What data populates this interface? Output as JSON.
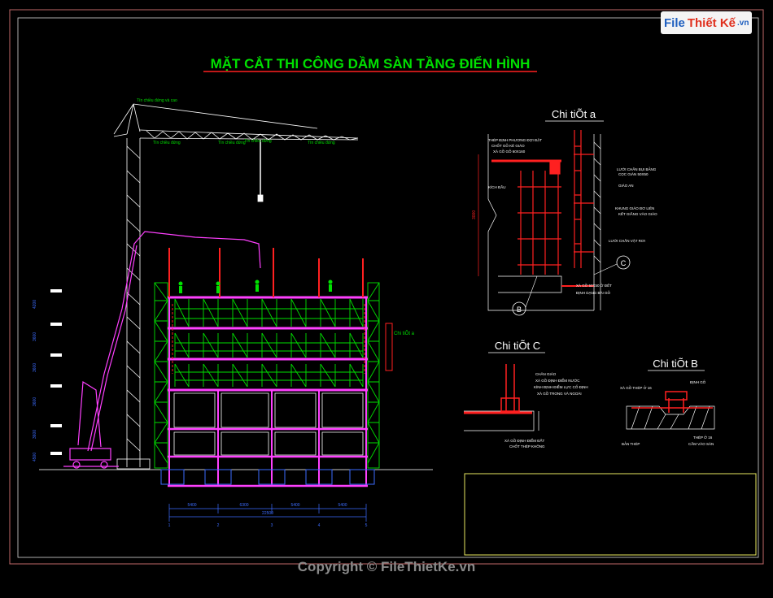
{
  "title": "MẶT CẮT THI CÔNG DẦM SÀN TẦNG ĐIỂN HÌNH",
  "logo": {
    "part1": "File",
    "part2": "Thiết Kế",
    "part3": ".vn"
  },
  "copyright": "Copyright © FileThietKe.vn",
  "detail_a": {
    "title": "Chi tiÕt a",
    "dim": "3000",
    "notes": [
      "THÉP ĐỊNH PHƯƠNG ĐỢI ĐẶT",
      "CHỐT GỖ KÊ GIÁO",
      "XÀ GỒ GỖ 60X160",
      "LƯỚI CHẮN BỤI BẢNG",
      "CỌC GIÀN 50X50",
      "GIÁO AN",
      "KHUNG GIÁO ĐƠ LIÊN",
      "KẾT GIẰNG VÀO GIÁO",
      "LƯỚI CHẮN VẬT RƠI",
      "XÀ GỒ 50X50 Ở ĐẾT",
      "ĐỊNH DẠNG BÀI GỖ"
    ],
    "callout_left": "B",
    "callout_right": "C"
  },
  "detail_c": {
    "title": "Chi tiÕt C",
    "notes": [
      "CHÂN GIÁO",
      "XÀ GỒ ĐỊNH ĐIỂM NƯỚC",
      "KÍNH ĐỊNH ĐIỂM LỰC CỐ ĐỊNH",
      "XÀ GỒ TRONG VÀ NGOÀI",
      "XÀ GỒ ĐỊNH ĐIỂM ĐẤT",
      "CHỐT THÉP KHÔNG"
    ]
  },
  "detail_b": {
    "title": "Chi tiÕt B",
    "notes": [
      "XÀ GỒ THÉP Ở 16",
      "ĐỊNH GỖ",
      "BẢN THÉP",
      "THÉP Ở 16",
      "CẮM VÀO SÀN"
    ]
  },
  "elevation": {
    "crane_label": "Tín chiều đứng và cao",
    "crane_notes": [
      "Tín chiều đứng",
      "Tín chiều đứng",
      "Tín chiều đứng",
      "Tín chiều đứng"
    ],
    "detail_ref": "Chi tiÕt a",
    "bay_dims": [
      "5400",
      "6300",
      "5400",
      "5400"
    ],
    "total_dim": "22500",
    "level_dims": [
      "4200",
      "3600",
      "3600",
      "3600",
      "3600",
      "4500"
    ],
    "grid_labels": [
      "1",
      "2",
      "3",
      "4",
      "5"
    ]
  },
  "colors": {
    "green": "#00e000",
    "red": "#ff2020",
    "magenta": "#ff40ff",
    "white": "#ffffff",
    "cyan": "#00d8d8",
    "yellow": "#ffff00",
    "blue": "#3c6cff",
    "border": "#d07070",
    "titlebox": "#e8e860"
  }
}
